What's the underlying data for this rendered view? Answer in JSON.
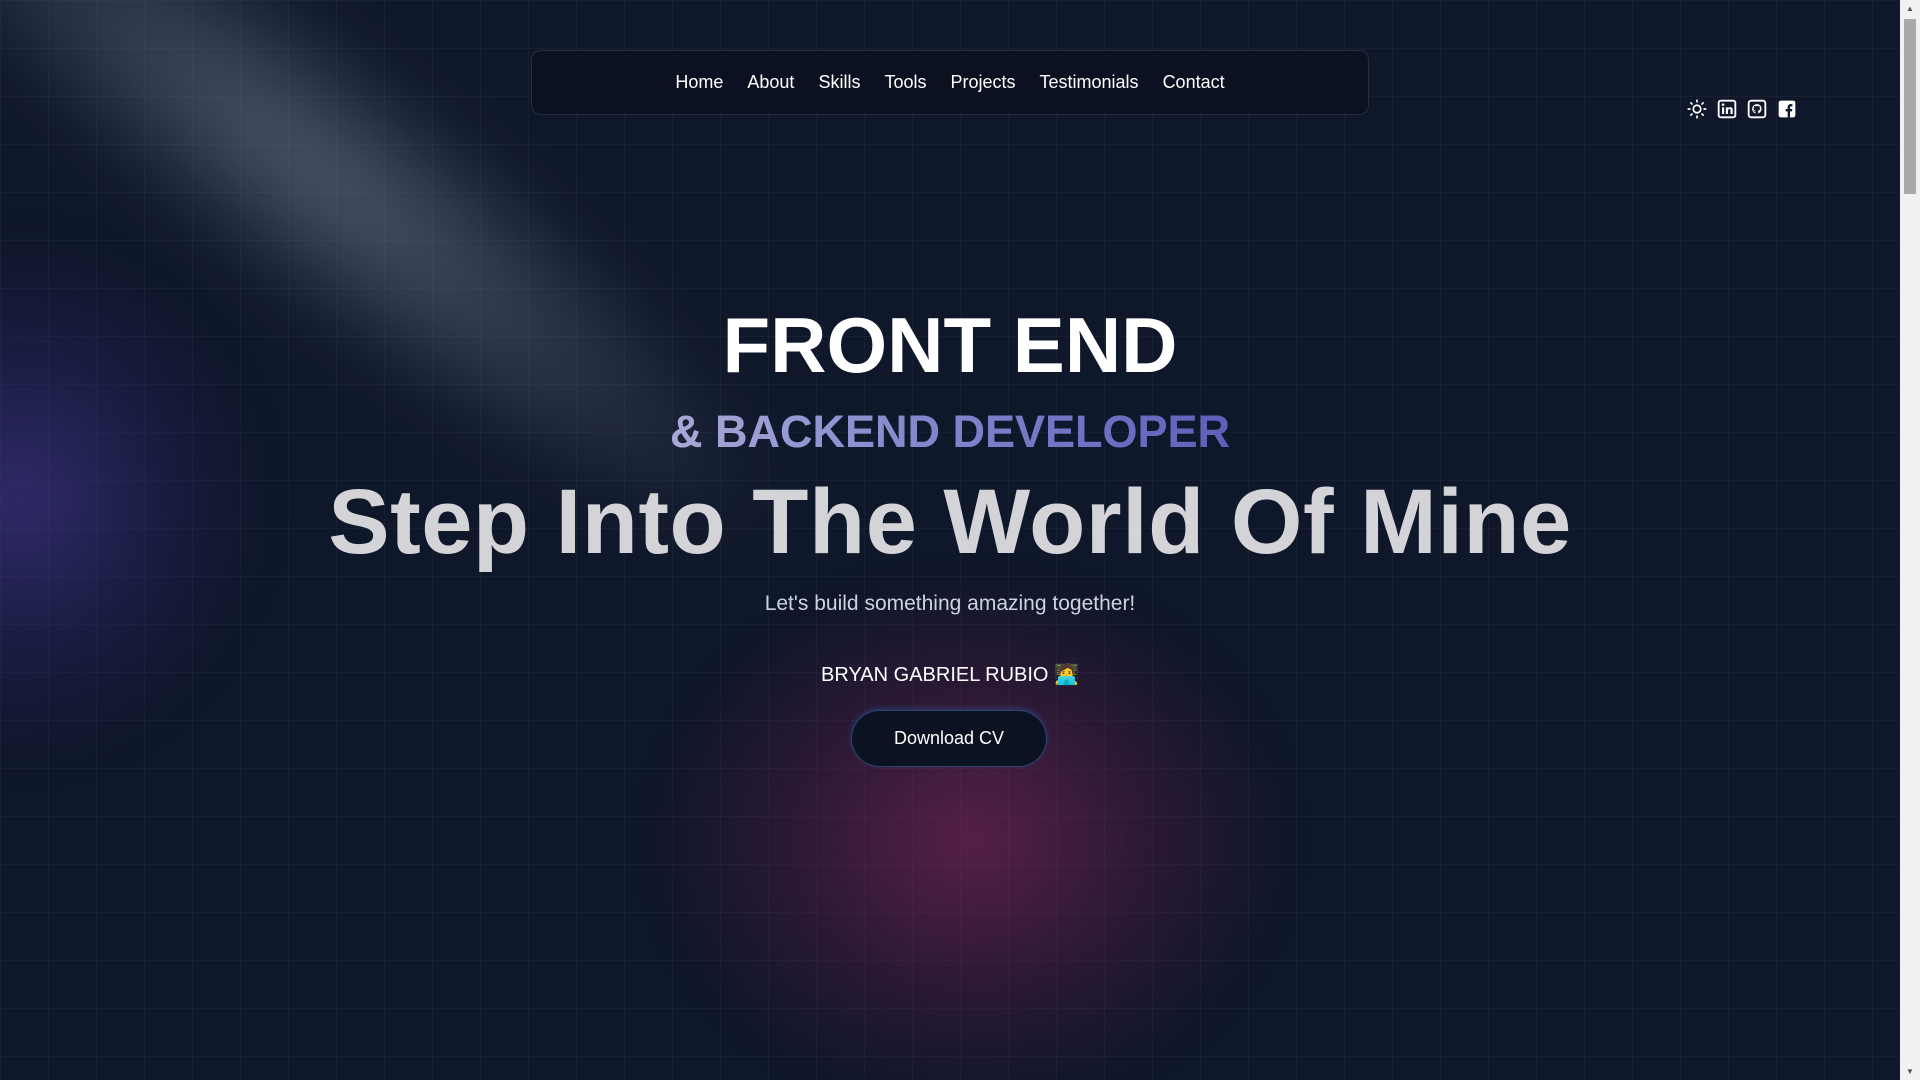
{
  "nav": {
    "items": [
      {
        "label": "Home"
      },
      {
        "label": "About"
      },
      {
        "label": "Skills"
      },
      {
        "label": "Tools"
      },
      {
        "label": "Projects"
      },
      {
        "label": "Testimonials"
      },
      {
        "label": "Contact"
      }
    ]
  },
  "social": {
    "icons": [
      "sun-icon",
      "linkedin-icon",
      "github-icon",
      "facebook-icon"
    ]
  },
  "hero": {
    "title": "FRONT END",
    "subtitle": "& BACKEND DEVELOPER",
    "headline": "Step Into The World Of Mine",
    "tagline": "Let's build something amazing together!",
    "name": "BRYAN GABRIEL RUBIO",
    "name_emoji": "🧑‍💻",
    "cta_label": "Download CV"
  },
  "colors": {
    "background": "#0f172a",
    "subtitle_gradient_start": "#a7a9d6",
    "subtitle_gradient_end": "#5e5fb9",
    "magenta_glow": "#962864",
    "purple_glow": "#4c3ca0"
  }
}
